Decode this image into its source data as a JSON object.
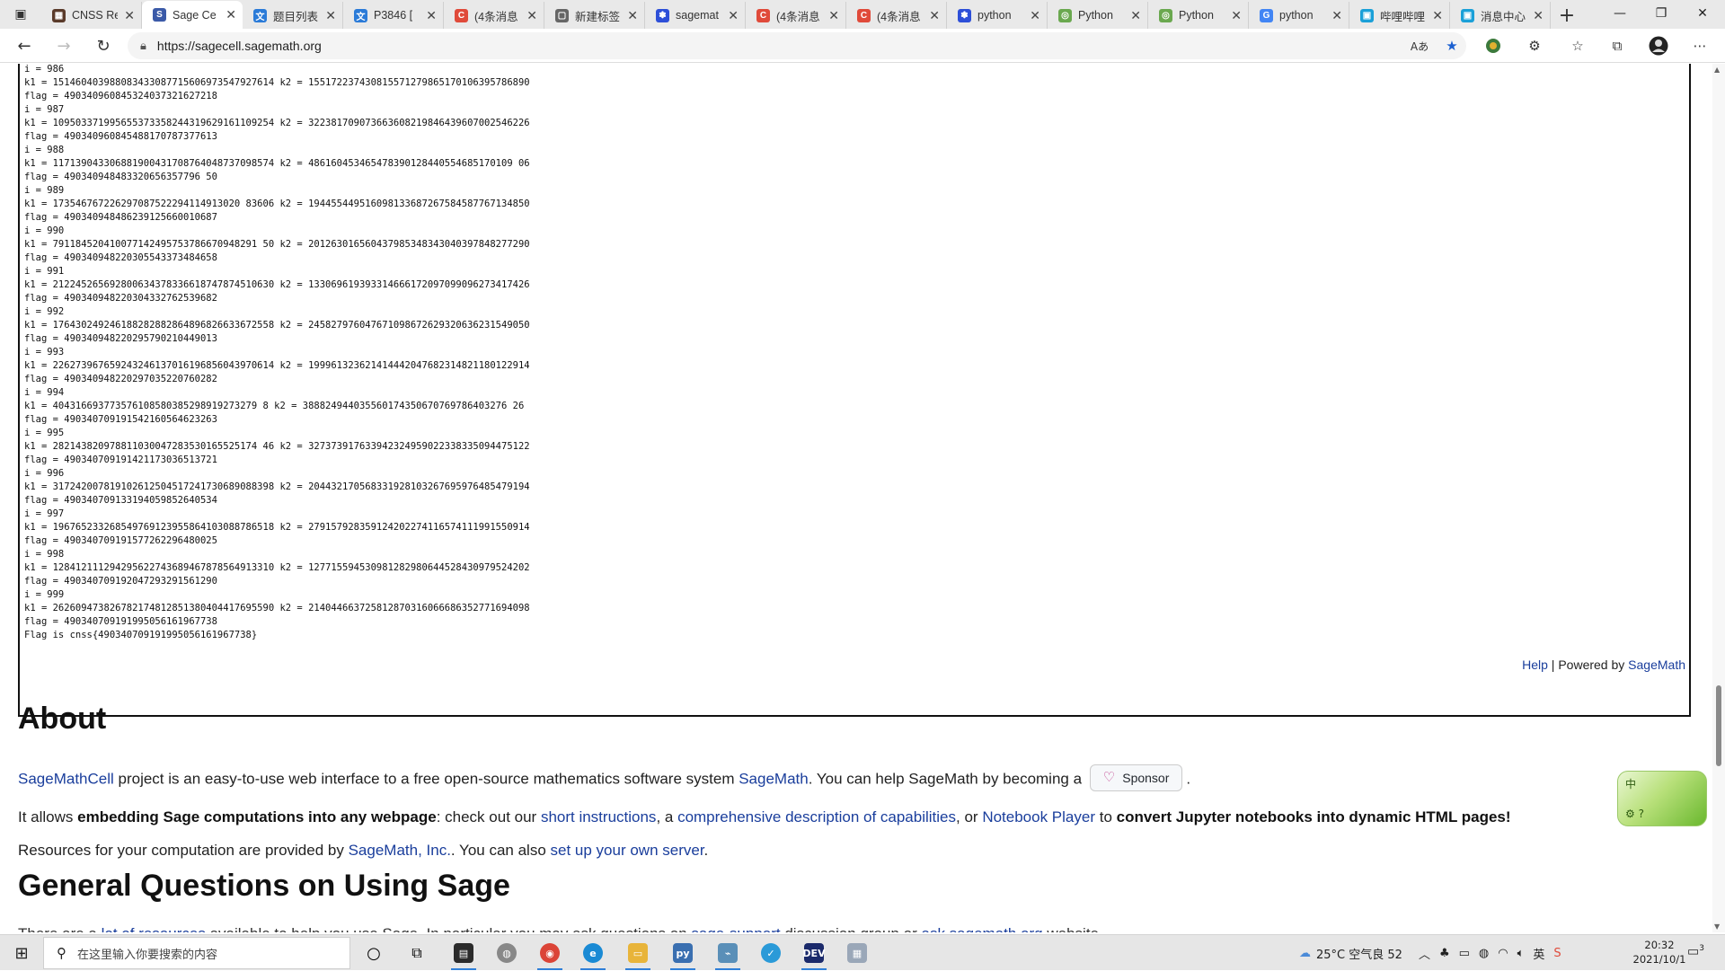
{
  "browser": {
    "tabs": [
      {
        "label": "CNSS Re",
        "icon": "cnss-favicon",
        "color": "#5a3a2a",
        "glyph": "▦"
      },
      {
        "label": "Sage Ce",
        "icon": "sage-favicon",
        "color": "#3b5aa8",
        "glyph": "S",
        "active": true
      },
      {
        "label": "题目列表",
        "icon": "problem-list-favicon",
        "color": "#2b7bd8",
        "glyph": "文"
      },
      {
        "label": "P3846 [",
        "icon": "luogu-favicon",
        "color": "#2b7bd8",
        "glyph": "文"
      },
      {
        "label": "(4条消息",
        "icon": "csdn-favicon",
        "color": "#e04a3a",
        "glyph": "C"
      },
      {
        "label": "新建标签",
        "icon": "page-favicon",
        "color": "#666666",
        "glyph": "▢"
      },
      {
        "label": "sagemat",
        "icon": "baidu-favicon",
        "color": "#2d4fd8",
        "glyph": "✽"
      },
      {
        "label": "(4条消息",
        "icon": "csdn-favicon",
        "color": "#e04a3a",
        "glyph": "C"
      },
      {
        "label": "(4条消息",
        "icon": "csdn-favicon",
        "color": "#e04a3a",
        "glyph": "C"
      },
      {
        "label": "python",
        "icon": "baidu-favicon",
        "color": "#2d4fd8",
        "glyph": "✽"
      },
      {
        "label": "Python",
        "icon": "runoob-favicon",
        "color": "#6aa84f",
        "glyph": "◎"
      },
      {
        "label": "Python",
        "icon": "runoob-favicon",
        "color": "#6aa84f",
        "glyph": "◎"
      },
      {
        "label": "python",
        "icon": "google-favicon",
        "color": "#4285f4",
        "glyph": "G"
      },
      {
        "label": "哔哩哔哩",
        "icon": "bilibili-favicon",
        "color": "#1aa0d8",
        "glyph": "▣"
      },
      {
        "label": "消息中心",
        "icon": "bilibili-favicon",
        "color": "#1aa0d8",
        "glyph": "▣"
      }
    ],
    "url": "https://sagecell.sagemath.org"
  },
  "output": {
    "lines": [
      "i = 986",
      "k1 = 15146040398808343308771560697354792761­4 k2 = 155172237430815571279865170106395786890",
      "flag = 490340960845324037321627218",
      "i = 987",
      "k1 = 109503371995655373358244319629161109254 k2 = 322381709073663608219846439607002546226",
      "flag = 490340960845488170787377613",
      "i = 988",
      "k1 = 117139043306881900431708764048737098574 k2 = 486160453465478390128440554685170109 06",
      "flag = 490340948483320656357796 50",
      "i = 989",
      "k1 = 173546767226297087522294114913020 83606 k2 = 194455449516098133687267584587767134850",
      "flag = 490340948486239125660010687",
      "i = 990",
      "k1 = 791184520410077142495753786670948291 50 k2 = 201263016560437985348343040397848277290",
      "flag = 490340948220305543373484658",
      "i = 991",
      "k1 = 212245265692800634378336618747874510630 k2 = 133069619393314666172097099096273417426",
      "flag = 490340948220304332762539682",
      "i = 992",
      "k1 = 176430249246188282882864896826633672558 k2 = 245827976047671098672629320636231549050",
      "flag = 490340948220295790210449013",
      "i = 993",
      "k1 = 226273967659243246137016196856043970614 k2 = 199961323621414442047682314821180122914",
      "flag = 490340948220297035220760282",
      "i = 994",
      "k1 = 404316693773576108580385298919273279 8 k2 = 388824944035560174350670769786403276 26",
      "flag = 490340709191542160564623263",
      "i = 995",
      "k1 = 282143820978811030047283530165525174 46 k2 = 327373917633942324959022338335094475122",
      "flag = 490340709191421173036513721",
      "i = 996",
      "k1 = 317242007819102612504517241730689088398 k2 = 204432170568331928103267695976485479194",
      "flag = 490340709133194059852640534",
      "i = 997",
      "k1 = 196765233268549769123955864103088786518 k2 = 279157928359124202274116574111991550914",
      "flag = 490340709191577262296480025",
      "i = 998",
      "k1 = 128412111294295622743689467878564913310 k2 = 127715594530981282980644528430979524202",
      "flag = 490340709192047293291561290",
      "i = 999",
      "k1 = 262609473826782174812851380404417695590 k2 = 214044663725812870316066686352771694098",
      "flag = 490340709191995056161967738",
      "Flag is cnss{490340709191995056161967738}"
    ]
  },
  "footer_links": {
    "help": "Help",
    "sep": " | Powered by ",
    "sagemath": "SageMath"
  },
  "about": {
    "title": "About",
    "p1_link1": "SageMathCell",
    "p1_text1": " project is an easy-to-use web interface to a free open-source mathematics software system ",
    "p1_link2": "SageMath",
    "p1_text2": ". You can help SageMath by becoming a ",
    "sponsor_label": "Sponsor",
    "p1_end": ".",
    "p2_text1": "It allows ",
    "p2_bold1": "embedding Sage computations into any webpage",
    "p2_text2": ": check out our ",
    "p2_link1": "short instructions",
    "p2_text3": ", a ",
    "p2_link2": "comprehensive description of capabilities",
    "p2_text4": ", or ",
    "p2_link3": "Notebook Player",
    "p2_text5": " to ",
    "p2_bold2": "convert Jupyter notebooks into dynamic HTML pages!",
    "p3_text1": "Resources for your computation are provided by ",
    "p3_link1": "SageMath, Inc.",
    "p3_text2": ". You can also ",
    "p3_link2": "set up your own server",
    "p3_end": "."
  },
  "general": {
    "title": "General Questions on Using Sage",
    "p_text1": "There are a ",
    "p_link1": "lot of resources",
    "p_text2": " available to help you use Sage. In particular you may ask questions on ",
    "p_link2": "sage-support",
    "p_text3": " discussion group or ",
    "p_link3": "ask.sagemath.org",
    "p_text4": " website."
  },
  "ime": {
    "label1": "中",
    "label2": "⚙ ?"
  },
  "taskbar": {
    "search_placeholder": "在这里输入你要搜索的内容",
    "weather": "25°C 空气良 52",
    "time": "20:32",
    "date": "2021/10/1",
    "notifications": "3"
  }
}
